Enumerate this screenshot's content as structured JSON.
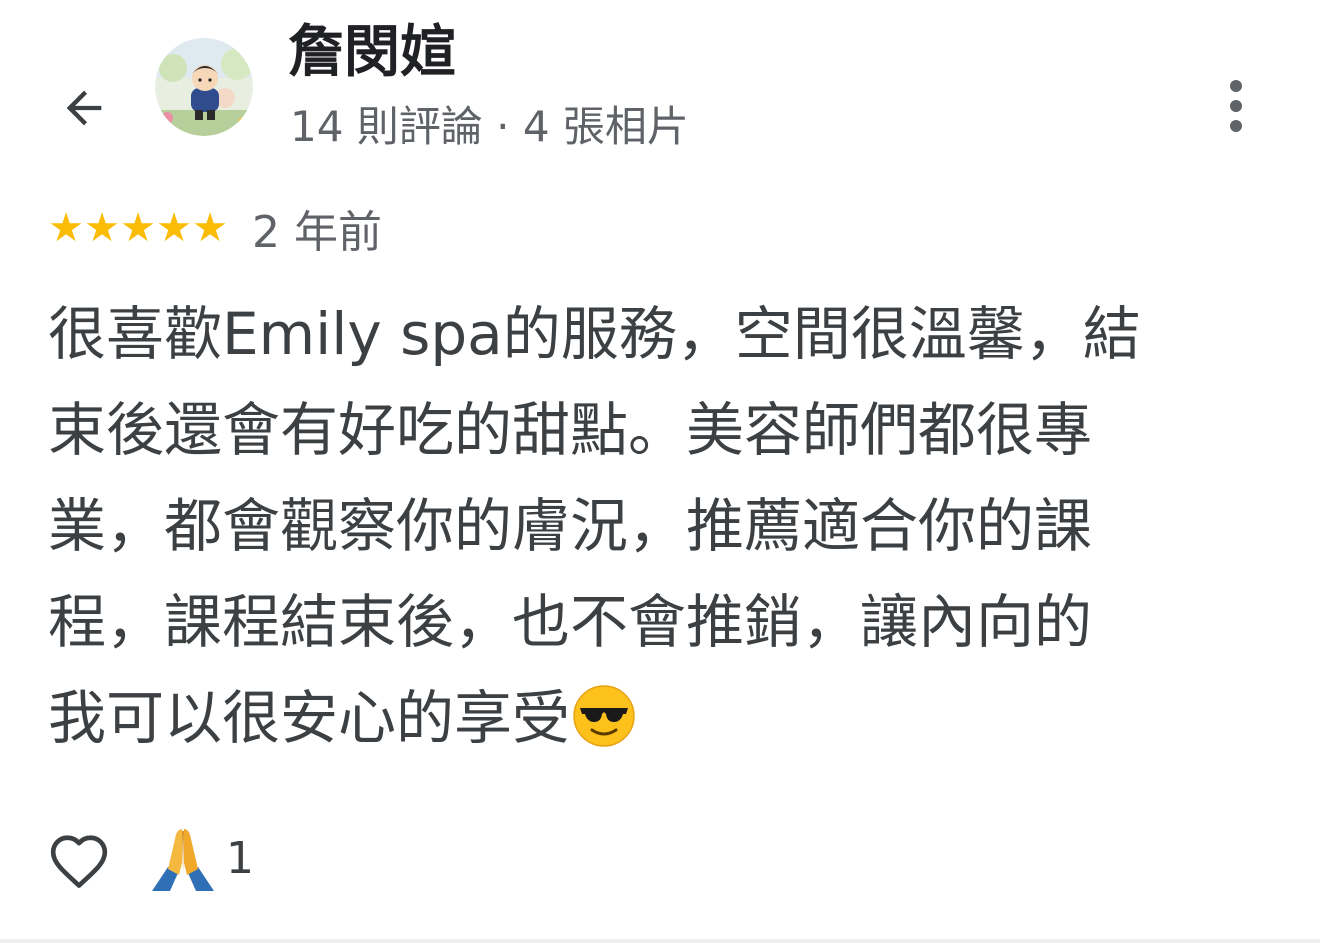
{
  "header": {
    "back_icon": "arrow-left-icon",
    "reviewer_name": "詹閔媗",
    "reviewer_stats": "14 則評論 · 4 張相片",
    "more_icon": "more-vertical-icon"
  },
  "review": {
    "rating": 5,
    "rating_max": 5,
    "star_color": "#fbbc04",
    "date": "2 年前",
    "text_lines": [
      "很喜歡Emily spa的服務，空間很溫馨，結",
      "束後還會有好吃的甜點。美容師們都很專",
      "業，都會觀察你的膚況，推薦適合你的課",
      "程，課程結束後，也不會推銷，讓內向的",
      "我可以很安心的享受"
    ],
    "trailing_emoji": "smiling-face-with-sunglasses"
  },
  "actions": {
    "like_icon": "heart-outline-icon",
    "reaction_icon": "folded-hands-icon",
    "reaction_count": "1"
  }
}
